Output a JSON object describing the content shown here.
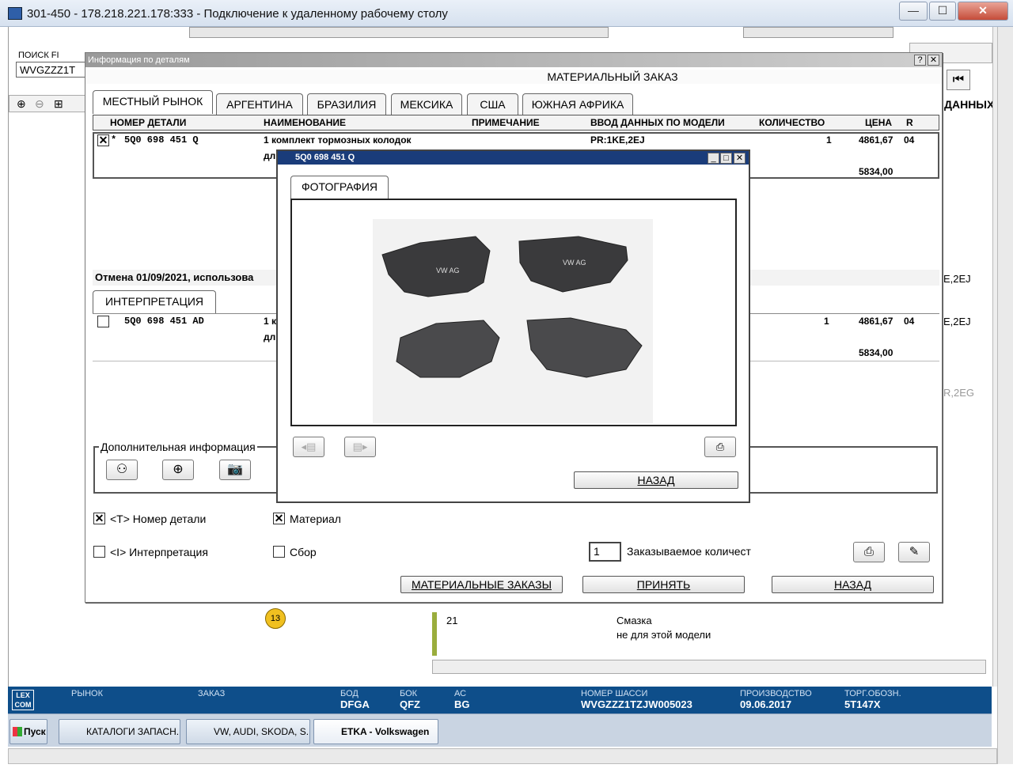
{
  "rdp": {
    "title": "301-450 - 178.218.221.178:333 - Подключение к удаленному рабочему столу",
    "min": "—",
    "max": "☐",
    "close": "✕"
  },
  "background": {
    "search_label": "ПОИСК FI",
    "search_value": "WVGZZZ1T",
    "right_header": "ДАННЫХ",
    "row_codes": [
      "E,2EJ",
      "E,2EJ",
      "R,2EG"
    ],
    "list_item": {
      "number": "21",
      "name": "Смазка",
      "note": "не для этой модели"
    },
    "callout": "13"
  },
  "dialog": {
    "title": "Информация по деталям",
    "help": "?",
    "close": "✕",
    "heading": "МАТЕРИАЛЬНЫЙ ЗАКАЗ",
    "tabs": [
      "МЕСТНЫЙ РЫНОК",
      "АРГЕНТИНА",
      "БРАЗИЛИЯ",
      "МЕКСИКА",
      "США",
      "ЮЖНАЯ АФРИКА"
    ],
    "columns": {
      "part_no": "НОМЕР ДЕТАЛИ",
      "name": "НАИМЕНОВАНИЕ",
      "note": "ПРИМЕЧАНИЕ",
      "model": "ВВОД ДАННЫХ ПО МОДЕЛИ",
      "qty": "КОЛИЧЕСТВО",
      "price": "ЦЕНА",
      "r": "R"
    },
    "row1": {
      "check": "✕",
      "star": "*",
      "part_no": "5Q0 698 451 Q",
      "name": "1 комплект тормозных колодок",
      "name2": "дл",
      "model": "PR:1KE,2EJ",
      "qty": "1",
      "price": "4861,67",
      "r": "04",
      "price2": "5834,00"
    },
    "cancel_text": "Отмена 01/09/2021, использова",
    "interp_tab": "ИНТЕРПРЕТАЦИЯ",
    "row2": {
      "part_no": "5Q0 698 451 AD",
      "name": "1 к",
      "name2": "дл",
      "qty": "1",
      "price": "4861,67",
      "r": "04",
      "price2": "5834,00"
    },
    "extra_label": "Дополнительная информация",
    "opt_partno": "<T> Номер детали",
    "opt_material": "Материал",
    "opt_interp": "<I> Интерпретация",
    "opt_assembly": "Сбор",
    "order_qty_value": "1",
    "order_qty_label": "Заказываемое количест",
    "btn_orders": "МАТЕРИАЛЬНЫЕ ЗАКАЗЫ",
    "btn_accept": "ПРИНЯТЬ",
    "btn_back": "НАЗАД"
  },
  "photo": {
    "title": "5Q0 698 451 Q",
    "tab": "ФОТОГРАФИЯ",
    "back": "НАЗАД",
    "pad_text": "VW AG"
  },
  "status": {
    "logo": "LEX COM",
    "market_label": "РЫНОК",
    "order_label": "ЗАКАЗ",
    "bod_label": "БОД",
    "bod": "DFGA",
    "bok_label": "БОК",
    "bok": "QFZ",
    "ac_label": "АС",
    "ac": "BG",
    "chassis_label": "НОМЕР ШАССИ",
    "chassis": "WVGZZZ1TZJW005023",
    "prod_label": "ПРОИЗВОДСТВО",
    "prod": "09.06.2017",
    "trade_label": "ТОРГ.ОБОЗН.",
    "trade": "5T147X"
  },
  "taskbar": {
    "start": "Пуск",
    "items": [
      "КАТАЛОГИ ЗАПАСН...",
      "VW, AUDI, SKODA, S...",
      "ETKA - Volkswagen"
    ]
  }
}
